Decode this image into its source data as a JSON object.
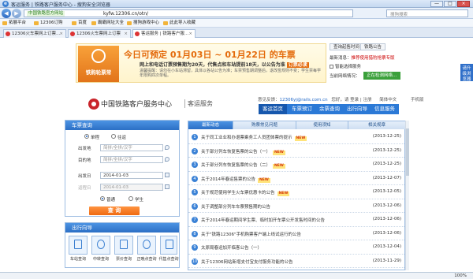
{
  "window": {
    "title": "客运服务 | 铁路客户服务中心 - 搜狗安全浏览器",
    "ie_glyph": "e",
    "minimize": "—",
    "maximize": "□",
    "close": "×"
  },
  "address": {
    "back": "◀",
    "forward": "▶",
    "verified_label": "中国铁路官方网站",
    "url": "kyfw.12306.cn/otn/",
    "search_placeholder": "搜狗搜索"
  },
  "favorites": [
    {
      "label": "拓展平台"
    },
    {
      "label": "12306订购"
    },
    {
      "label": "百度"
    },
    {
      "label": "霸霸网址大全"
    },
    {
      "label": "搜狗游戏中心"
    },
    {
      "label": "此此导入收藏"
    }
  ],
  "tabs": [
    {
      "label": "12306火车票网上订票…",
      "close": "×"
    },
    {
      "label": "12306火车票网上订票",
      "close": "×"
    },
    {
      "label": "客运服务 | 铁路客户服…",
      "close": "×"
    }
  ],
  "banner": {
    "badge_label": "铁购轮票常",
    "headline": "今日可预定 01月03日 ~ 01月22日 的车票",
    "sub": "网上和电话订票预售期为20天，代售点和车站提前18天，以公告为准",
    "sub_link": "订票必读",
    "note": "温馨提醒：请勿在小车站滞留，具体以各站公告为准；车票预售期调整后，退改签规则不变；学生票每学年限购四次单程。"
  },
  "info": {
    "btn1": "查询起售时间",
    "btn2": "铁路公告",
    "line1_label": "最新消息：",
    "line1_value": "推荐使用猎豹抢票专版",
    "line2": "智能选择服务",
    "line3_label": "当前网络情况：",
    "line3_btn": "正在检测网络…",
    "support": "请升级浏览器"
  },
  "header": {
    "brand": "中国铁路客户服务中心",
    "brand2": "客运服务",
    "toplinks_prefix": "意见反馈：",
    "email": "12306yj@rails.com.cn",
    "links": "您好，请 登录 | 注册",
    "lang": "简体中文",
    "mobile": "手机版",
    "nav": [
      "客运首页",
      "车票预订",
      "余票查询",
      "出行向导",
      "信息服务"
    ]
  },
  "query": {
    "title": "车票查询",
    "type_oneway": "单程",
    "type_return": "往返",
    "from_label": "出发地",
    "from_ph": "简拼/全拼/汉字",
    "to_label": "目的地",
    "to_ph": "简拼/全拼/汉字",
    "date_label": "出发日",
    "date_value": "2014-01-03",
    "return_label": "返程日",
    "return_value": "2014-01-03",
    "ticket_normal": "普通",
    "ticket_student": "学生",
    "submit": "查 询"
  },
  "guide": {
    "title": "出行向导",
    "items": [
      "车站查询",
      "中转查询",
      "票价查询",
      "正晚点查询",
      "代售点查询"
    ]
  },
  "announce": {
    "tabs": [
      "最新动态",
      "购票常见问题",
      "使用须知",
      "相关规章"
    ],
    "new_tag": "NEW",
    "items": [
      {
        "num": "1",
        "title": "关于同工业业和办退票乘务工人员团体票的提示",
        "new": true,
        "date": "(2013-12-25)"
      },
      {
        "num": "2",
        "title": "关于部分列车恢复售票的公告（一）",
        "new": true,
        "date": "(2013-12-25)"
      },
      {
        "num": "3",
        "title": "关于部分列车恢复售票的公告（二）",
        "new": true,
        "date": "(2013-12-25)"
      },
      {
        "num": "4",
        "title": "关于2014年春运售票的公告",
        "new": true,
        "date": "(2013-12-07)"
      },
      {
        "num": "5",
        "title": "关于规范使用学生火车票优惠卡的公告",
        "new": true,
        "date": "(2013-12-05)"
      },
      {
        "num": "6",
        "title": "关于调整部分列车车票预售期的公告",
        "new": false,
        "date": "(2013-12-06)"
      },
      {
        "num": "7",
        "title": "关于2014年春运期间学生票、临时加开车票公开发售时间的公告",
        "new": false,
        "date": "(2013-12-06)"
      },
      {
        "num": "8",
        "title": "关于\"铁路12306\"手机购票客户端上线试运行的公告",
        "new": false,
        "date": "(2013-12-06)"
      },
      {
        "num": "9",
        "title": "太原局春运加开临客公告（一）",
        "new": false,
        "date": "(2013-12-04)"
      },
      {
        "num": "10",
        "title": "关于12306网站新增支付宝支付服务功能的公告",
        "new": false,
        "date": "(2013-11-29)"
      }
    ]
  },
  "status": {
    "zoom": "100%"
  }
}
